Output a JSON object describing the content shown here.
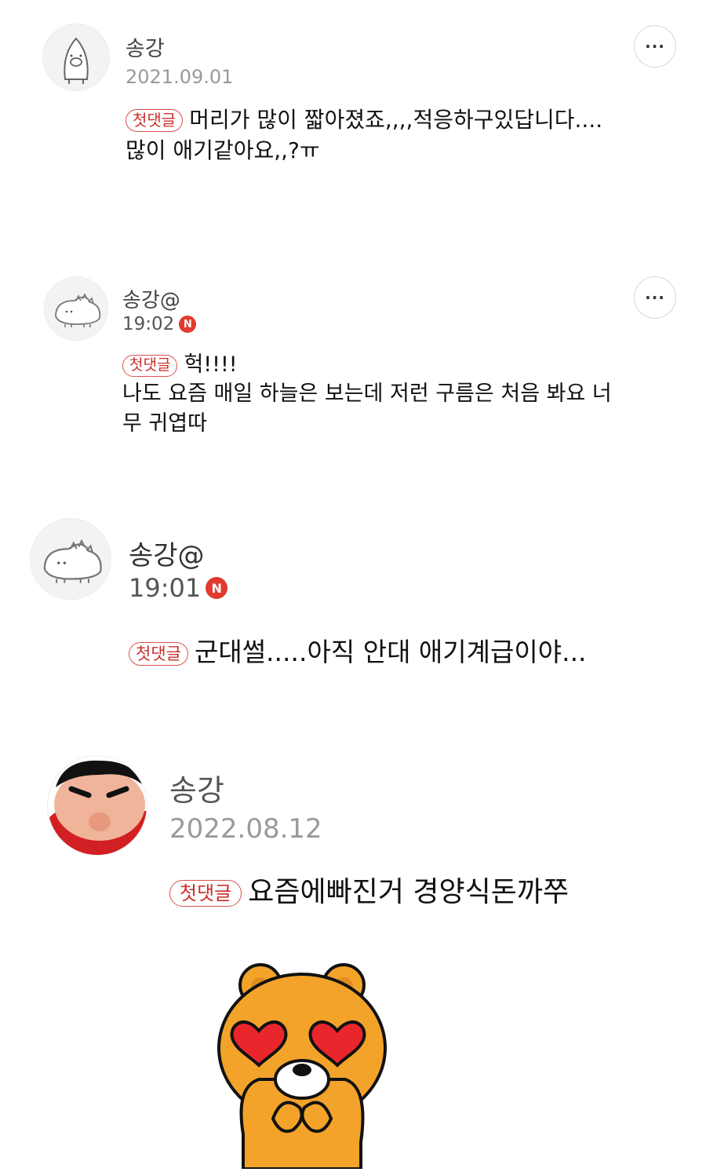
{
  "comments": [
    {
      "author": "송강",
      "date": "2021.09.01",
      "badge": "첫댓글",
      "text": "머리가 많이 짧아졌죠,,,,적응하구있답니다....\n많이 애기같아요,,?ㅠ",
      "avatar_icon": "pig-cat-avatar-icon",
      "more_label": "···"
    },
    {
      "author": "송강@",
      "date": "19:02",
      "new_badge": "N",
      "badge": "첫댓글",
      "text": "헉!!!!\n나도 요즘 매일 하늘은 보는데 저런 구름은 처음 봐요 너\n무 귀엽따",
      "avatar_icon": "dinosaur-avatar-icon",
      "more_label": "···"
    },
    {
      "author": "송강@",
      "date": "19:01",
      "new_badge": "N",
      "badge": "첫댓글",
      "text": "군대썰.....아직 안대 애기계급이야...",
      "avatar_icon": "dinosaur-avatar-icon"
    },
    {
      "author": "송강",
      "date": "2022.08.12",
      "badge": "첫댓글",
      "text": "요즘에빠진거 경양식돈까쭈",
      "avatar_icon": "cartoon-boy-avatar-icon",
      "sticker_icon": "bear-heart-eyes-sticker-icon"
    }
  ]
}
